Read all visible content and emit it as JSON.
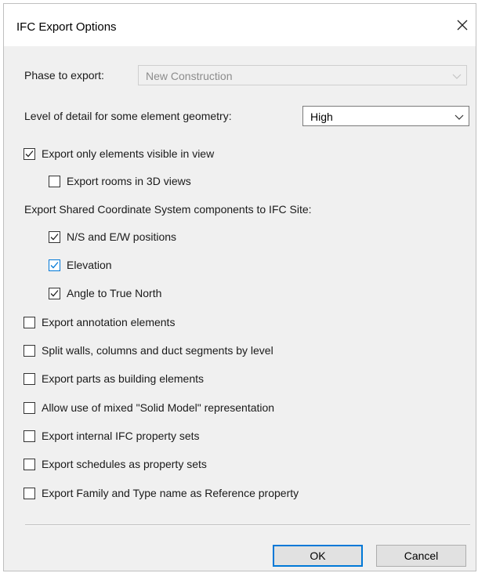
{
  "window": {
    "title": "IFC Export Options",
    "close_icon": "close-icon"
  },
  "phase": {
    "label": "Phase to export:",
    "value": "New Construction"
  },
  "detail": {
    "label": "Level of detail for some element geometry:",
    "value": "High"
  },
  "options": {
    "visible_only": {
      "label": "Export only elements visible in view",
      "checked": true
    },
    "rooms_3d": {
      "label": "Export rooms in 3D views",
      "checked": false
    },
    "shared_coords_heading": "Export Shared Coordinate System components to IFC Site:",
    "ns_ew": {
      "label": "N/S and E/W positions",
      "checked": true
    },
    "elevation": {
      "label": "Elevation",
      "checked": true
    },
    "true_north": {
      "label": "Angle to True North",
      "checked": true
    },
    "annotation": {
      "label": "Export annotation elements",
      "checked": false
    },
    "split_walls": {
      "label": "Split walls, columns and duct segments by level",
      "checked": false
    },
    "parts": {
      "label": "Export parts as building elements",
      "checked": false
    },
    "solid_model": {
      "label": "Allow use of mixed \"Solid Model\" representation",
      "checked": false
    },
    "internal_psets": {
      "label": "Export internal IFC property sets",
      "checked": false
    },
    "schedules": {
      "label": "Export schedules as property sets",
      "checked": false
    },
    "family_type": {
      "label": "Export Family and Type name as Reference property",
      "checked": false
    }
  },
  "buttons": {
    "ok": "OK",
    "cancel": "Cancel"
  },
  "colors": {
    "accent": "#0078d7",
    "dialog_bg": "#f0f0f0"
  }
}
